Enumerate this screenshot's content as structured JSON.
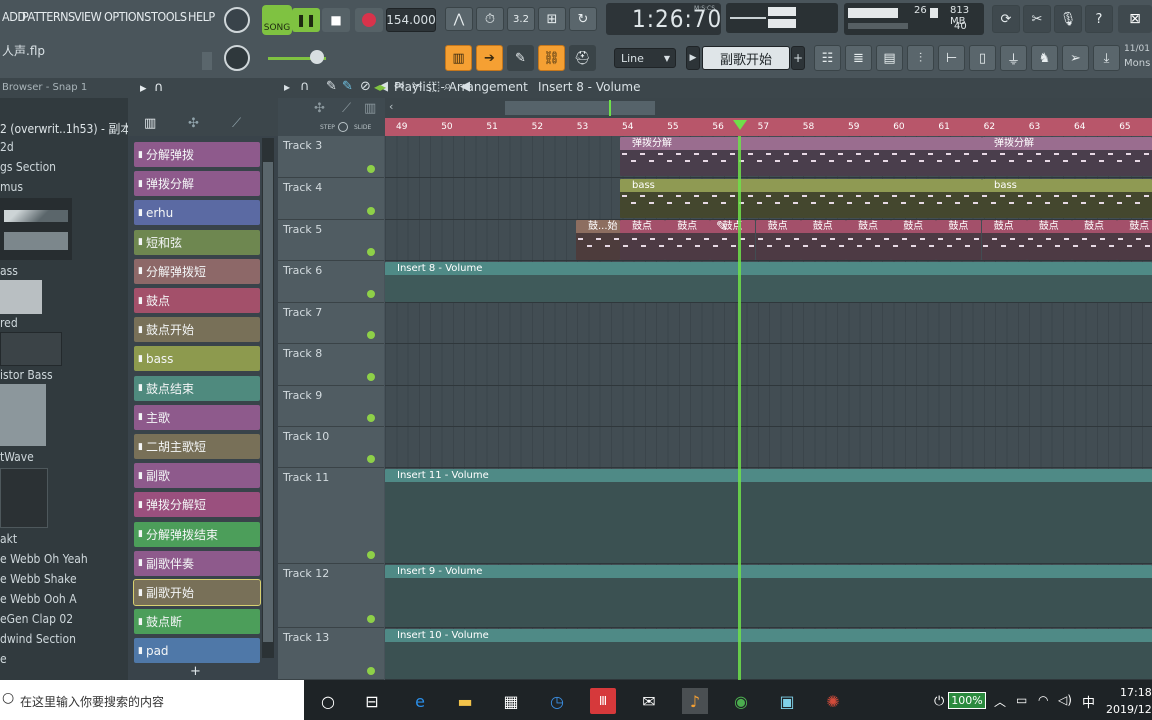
{
  "menu": [
    "ADD",
    "PATTERNS",
    "VIEW",
    "OPTIONS",
    "TOOLS",
    "HELP"
  ],
  "transport": {
    "song_label": "SONG",
    "tempo": "154.000",
    "time": "1:26:70",
    "time_tag": "M:S:CS",
    "memory": "813 MB",
    "cpu": "26",
    "poly": "40"
  },
  "project_file": "人声.flp",
  "snap_mode": "Line",
  "hint_text": "副歌开始",
  "date_text": "11/01",
  "mons_text": "Mons",
  "browser": {
    "title": "Browser - Snap 1",
    "items": [
      "2 (overwrit..1h53) - 副本",
      "2d",
      "gs Section",
      "mus",
      "ass",
      "red",
      "istor Bass",
      "tWave",
      "akt",
      "e Webb Oh Yeah",
      "e Webb Shake",
      "e Webb Ooh A",
      "eGen Clap 02",
      "dwind Section",
      "e"
    ]
  },
  "channels": [
    {
      "label": "分解弹拨",
      "color": "#8e5a8c"
    },
    {
      "label": "弹拨分解",
      "color": "#8e5a8c"
    },
    {
      "label": "erhu",
      "color": "#5b6aa3"
    },
    {
      "label": "短和弦",
      "color": "#6e8750"
    },
    {
      "label": "分解弹拨短",
      "color": "#8d6868"
    },
    {
      "label": "鼓点",
      "color": "#a3506a"
    },
    {
      "label": "鼓点开始",
      "color": "#787058"
    },
    {
      "label": "bass",
      "color": "#8d9a4e"
    },
    {
      "label": "鼓点结束",
      "color": "#4f8a7e"
    },
    {
      "label": "主歌",
      "color": "#8e5a8c"
    },
    {
      "label": "二胡主歌短",
      "color": "#787058"
    },
    {
      "label": "副歌",
      "color": "#8e5a8c"
    },
    {
      "label": "弹拨分解短",
      "color": "#9a507e"
    },
    {
      "label": "分解弹拨结束",
      "color": "#4c9e5a"
    },
    {
      "label": "副歌伴奏",
      "color": "#8e5a8c"
    },
    {
      "label": "副歌开始",
      "color": "#787058"
    },
    {
      "label": "鼓点断",
      "color": "#4c9e5a"
    },
    {
      "label": "pad",
      "color": "#4f78a8"
    }
  ],
  "playlist": {
    "title": "Playlist - Arrangement",
    "crumb": "Insert 8 - Volume",
    "step_label": "STEP",
    "slide_label": "SLIDE",
    "bars": [
      "49",
      "50",
      "51",
      "52",
      "53",
      "54",
      "55",
      "56",
      "57",
      "58",
      "59",
      "60",
      "61",
      "62",
      "63",
      "64",
      "65"
    ],
    "tracks": [
      "Track 3",
      "Track 4",
      "Track 5",
      "Track 6",
      "Track 7",
      "Track 8",
      "Track 9",
      "Track 10",
      "Track 11",
      "Track 12",
      "Track 13"
    ],
    "clips": {
      "t3a": "弹拨分解",
      "t3b": "弹拨分解",
      "t4a": "bass",
      "t4b": "bass",
      "t5start": "鼓...始",
      "t5pattern": "鼓点",
      "auto6": "Insert 8 - Volume",
      "auto11": "Insert 11 - Volume",
      "auto12": "Insert 9 - Volume",
      "auto13": "Insert 10 - Volume"
    }
  },
  "taskbar": {
    "search_placeholder": "在这里输入你要搜索的内容",
    "battery": "100%",
    "ime": "中",
    "time": "17:18",
    "date": "2019/12"
  },
  "colors": {
    "accent": "#f5a033",
    "song_green": "#7fc241",
    "playhead": "#6ee04a",
    "ruler": "#b8566a"
  }
}
